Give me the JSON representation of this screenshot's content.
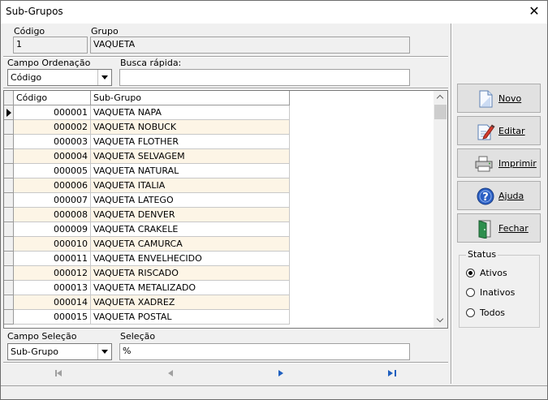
{
  "window": {
    "title": "Sub-Grupos",
    "close_glyph": "✕"
  },
  "header": {
    "codigo_label": "Código",
    "codigo_value": "1",
    "grupo_label": "Grupo",
    "grupo_value": "VAQUETA"
  },
  "ordering": {
    "campo_label": "Campo Ordenação",
    "campo_value": "Código",
    "busca_label": "Busca rápida:",
    "busca_value": ""
  },
  "grid": {
    "columns": [
      "Código",
      "Sub-Grupo"
    ],
    "rows": [
      {
        "codigo": "000001",
        "sub_grupo": "VAQUETA NAPA"
      },
      {
        "codigo": "000002",
        "sub_grupo": "VAQUETA NOBUCK"
      },
      {
        "codigo": "000003",
        "sub_grupo": "VAQUETA FLOTHER"
      },
      {
        "codigo": "000004",
        "sub_grupo": "VAQUETA SELVAGEM"
      },
      {
        "codigo": "000005",
        "sub_grupo": "VAQUETA NATURAL"
      },
      {
        "codigo": "000006",
        "sub_grupo": "VAQUETA ITALIA"
      },
      {
        "codigo": "000007",
        "sub_grupo": "VAQUETA LATEGO"
      },
      {
        "codigo": "000008",
        "sub_grupo": "VAQUETA DENVER"
      },
      {
        "codigo": "000009",
        "sub_grupo": "VAQUETA CRAKELE"
      },
      {
        "codigo": "000010",
        "sub_grupo": "VAQUETA CAMURCA"
      },
      {
        "codigo": "000011",
        "sub_grupo": "VAQUETA ENVELHECIDO"
      },
      {
        "codigo": "000012",
        "sub_grupo": "VAQUETA RISCADO"
      },
      {
        "codigo": "000013",
        "sub_grupo": "VAQUETA METALIZADO"
      },
      {
        "codigo": "000014",
        "sub_grupo": "VAQUETA XADREZ"
      },
      {
        "codigo": "000015",
        "sub_grupo": "VAQUETA POSTAL"
      }
    ]
  },
  "selection": {
    "campo_label": "Campo Seleção",
    "campo_value": "Sub-Grupo",
    "selecao_label": "Seleção",
    "selecao_value": "%"
  },
  "buttons": {
    "novo": "Novo",
    "editar": "Editar",
    "imprimir": "Imprimir",
    "ajuda": "Ajuda",
    "fechar": "Fechar"
  },
  "status": {
    "legend": "Status",
    "options": [
      "Ativos",
      "Inativos",
      "Todos"
    ],
    "selected": "Ativos"
  },
  "colors": {
    "row_alt": "#fdf5e6",
    "nav_active": "#1f5fbf",
    "nav_disabled": "#a0a0a0"
  }
}
